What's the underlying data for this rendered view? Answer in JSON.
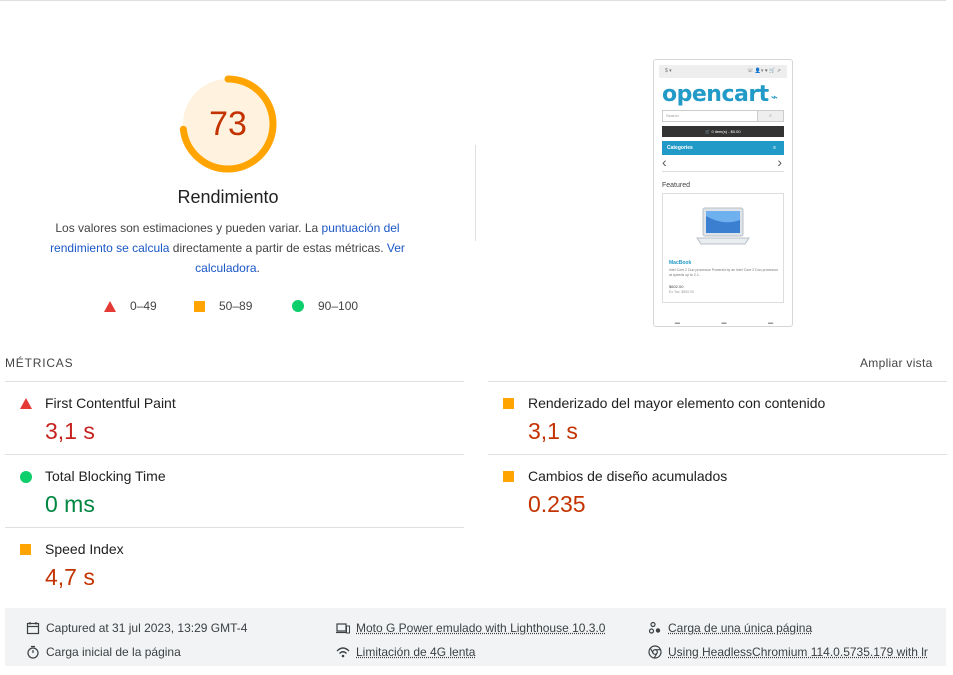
{
  "gauge": {
    "score": "73",
    "title": "Rendimiento",
    "fraction": 0.73,
    "color": "#ffa400",
    "bg": "#fff3e0"
  },
  "description": {
    "part1": "Los valores son estimaciones y pueden variar. La ",
    "link1": "puntuación del rendimiento se calcula",
    "part2": " directamente a partir de estas métricas. ",
    "link2": "Ver calculadora",
    "part3": "."
  },
  "legend": [
    {
      "range": "0–49",
      "shape": "triangle",
      "color": "#e53935"
    },
    {
      "range": "50–89",
      "shape": "square",
      "color": "#ffa400"
    },
    {
      "range": "90–100",
      "shape": "circle",
      "color": "#0cce6b"
    }
  ],
  "screenshot": {
    "logo": "opencart",
    "search_placeholder": "Search",
    "cart": "0 item(s) - $0.00",
    "categories": "Categories",
    "featured": "Featured",
    "product_name": "MacBook",
    "product_desc": "Intel Core 2 Duo processor Powered by an Intel Core 2 Duo processor at speeds up to 2.1..",
    "product_price": "$602.00",
    "product_tax": "Ex Tax: $500.00"
  },
  "metrics": {
    "heading": "MÉTRICAS",
    "expand_label": "Ampliar vista",
    "items": [
      {
        "name": "First Contentful Paint",
        "value": "3,1 s",
        "status": "red"
      },
      {
        "name": "Renderizado del mayor elemento con contenido",
        "value": "3,1 s",
        "status": "orange"
      },
      {
        "name": "Total Blocking Time",
        "value": "0 ms",
        "status": "green"
      },
      {
        "name": "Cambios de diseño acumulados",
        "value": "0.235",
        "status": "orange"
      },
      {
        "name": "Speed Index",
        "value": "4,7 s",
        "status": "orange"
      }
    ]
  },
  "footer": {
    "captured": "Captured at 31 jul 2023, 13:29 GMT-4",
    "initial_load": "Carga inicial de la página",
    "device": "Moto G Power emulado with Lighthouse 10.3.0",
    "throttling": "Limitación de 4G lenta",
    "single_page": "Carga de una única página",
    "browser": "Using HeadlessChromium 114.0.5735.179 with lr"
  }
}
